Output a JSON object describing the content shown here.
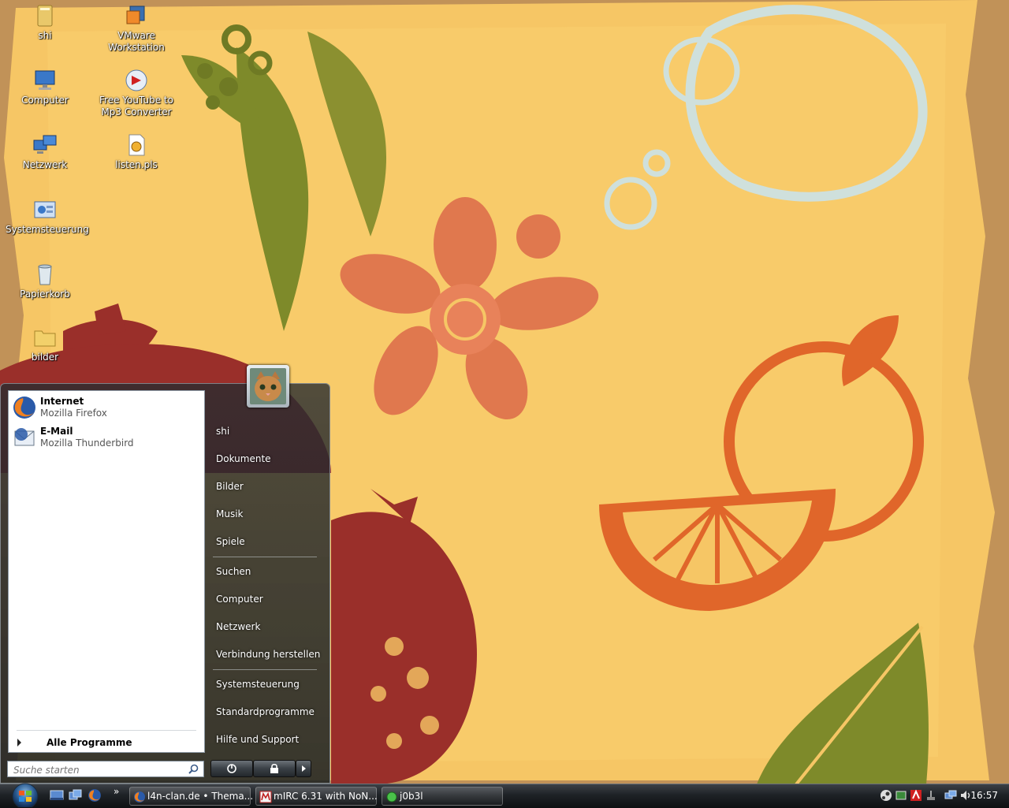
{
  "desktop": {
    "icons": [
      {
        "label": "shi"
      },
      {
        "label": "VMware Workstation"
      },
      {
        "label": "Computer"
      },
      {
        "label": "Free YouTube to Mp3 Converter"
      },
      {
        "label": "Netzwerk"
      },
      {
        "label": "listen.pls"
      },
      {
        "label": "Systemsteuerung"
      },
      {
        "label": "Papierkorb"
      },
      {
        "label": "bilder"
      }
    ]
  },
  "start_menu": {
    "pinned": [
      {
        "title": "Internet",
        "subtitle": "Mozilla Firefox",
        "icon": "firefox-icon"
      },
      {
        "title": "E-Mail",
        "subtitle": "Mozilla Thunderbird",
        "icon": "thunderbird-icon"
      }
    ],
    "all_programs": "Alle Programme",
    "search_placeholder": "Suche starten",
    "right_items": [
      "shi",
      "Dokumente",
      "Bilder",
      "Musik",
      "Spiele",
      "Suchen",
      "Computer",
      "Netzwerk",
      "Verbindung herstellen",
      "Systemsteuerung",
      "Standardprogramme",
      "Hilfe und Support"
    ]
  },
  "taskbar": {
    "quicklaunch_chevron": "»",
    "tasks": [
      {
        "label": "l4n-clan.de • Thema...",
        "icon": "firefox-icon"
      },
      {
        "label": "mIRC 6.31 with NoN...",
        "icon": "mirc-icon"
      },
      {
        "label": "j0b3l",
        "icon": "green-status-icon"
      }
    ],
    "clock": "16:57"
  }
}
